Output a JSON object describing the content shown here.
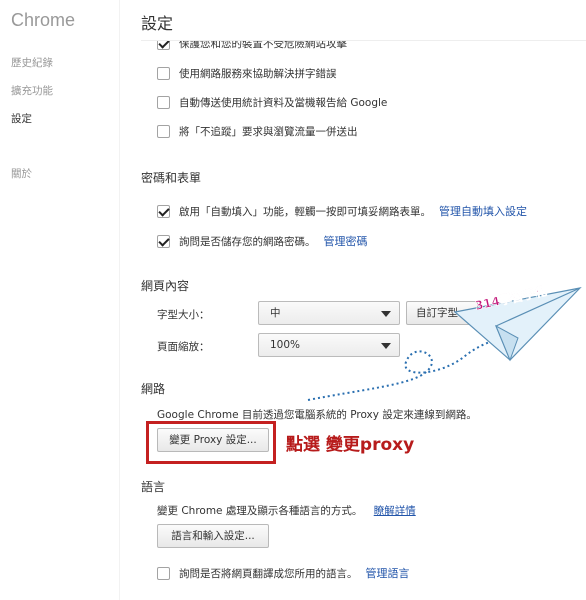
{
  "sidebar": {
    "app_title": "Chrome",
    "items": [
      {
        "label": "歷史紀錄"
      },
      {
        "label": "擴充功能"
      },
      {
        "label": "設定"
      },
      {
        "label": "關於"
      }
    ]
  },
  "header": {
    "title": "設定"
  },
  "privacy": {
    "rows": [
      {
        "label": "保護您和您的裝置不受危險網站攻擊",
        "checked": true
      },
      {
        "label": "使用網路服務來協助解決拼字錯誤",
        "checked": false
      },
      {
        "label": "自動傳送使用統計資料及當機報告給 Google",
        "checked": false
      },
      {
        "label": "將「不追蹤」要求與瀏覽流量一併送出",
        "checked": false
      }
    ]
  },
  "passwords": {
    "title": "密碼和表單",
    "autofill": {
      "label": "啟用「自動填入」功能，輕觸一按即可填妥網路表單。",
      "link": "管理自動填入設定",
      "checked": true
    },
    "save_passwords": {
      "label": "詢問是否儲存您的網路密碼。",
      "link": "管理密碼",
      "checked": true
    }
  },
  "web_content": {
    "title": "網頁內容",
    "font_size_label": "字型大小：",
    "font_size_value": "中",
    "custom_fonts_button": "自訂字型...",
    "zoom_label": "頁面縮放：",
    "zoom_value": "100%"
  },
  "network": {
    "title": "網路",
    "description": "Google Chrome 目前透過您電腦系統的 Proxy 設定來連線到網路。",
    "proxy_button": "變更 Proxy 設定...",
    "annotation": "點選  變更proxy"
  },
  "languages": {
    "title": "語言",
    "description": "變更 Chrome 處理及顯示各種語言的方式。",
    "learn_more": "瞭解詳情",
    "settings_button": "語言和輸入設定...",
    "translate": {
      "label": "詢問是否將網頁翻譯成您所用的語言。",
      "link": "管理語言",
      "checked": false
    }
  },
  "watermark": "314學習手札",
  "colors": {
    "highlight": "#c42020",
    "link": "#2255aa",
    "annotation": "#b71b1b"
  }
}
